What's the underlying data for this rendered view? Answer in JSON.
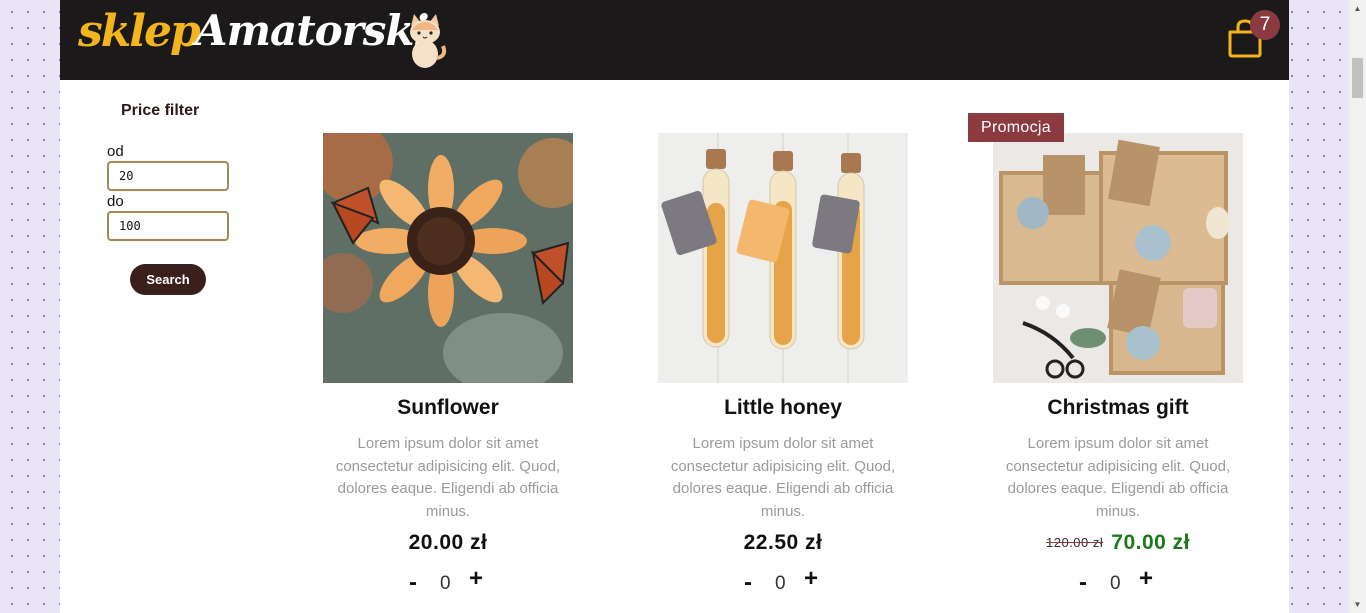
{
  "header": {
    "logo_part1": "sklep",
    "logo_part2": "Amatorski",
    "cart_count": "7"
  },
  "filter": {
    "title": "Price filter",
    "from_label": "od",
    "from_value": "20",
    "to_label": "do",
    "to_value": "100",
    "search_label": "Search"
  },
  "products": [
    {
      "name": "Sunflower",
      "description": "Lorem ipsum dolor sit amet consectetur adipisicing elit. Quod, dolores eaque. Eligendi ab officia minus.",
      "price": "20.00 zł",
      "quantity": "0",
      "image_icon": "sunflower-image"
    },
    {
      "name": "Little honey",
      "description": "Lorem ipsum dolor sit amet consectetur adipisicing elit. Quod, dolores eaque. Eligendi ab officia minus.",
      "price": "22.50 zł",
      "quantity": "0",
      "image_icon": "honey-tubes-image"
    },
    {
      "name": "Christmas gift",
      "description": "Lorem ipsum dolor sit amet consectetur adipisicing elit. Quod, dolores eaque. Eligendi ab officia minus.",
      "old_price": "120.00 zł",
      "price": "70.00 zł",
      "quantity": "0",
      "promo_label": "Promocja",
      "image_icon": "gift-box-image"
    }
  ],
  "qty_controls": {
    "minus": "-",
    "plus": "+"
  },
  "colors": {
    "header_bg": "#1b1919",
    "logo_accent": "#f4b41c",
    "badge": "#8b3a3f",
    "button": "#3b1f1d",
    "promo_price": "#1a7a1a"
  }
}
